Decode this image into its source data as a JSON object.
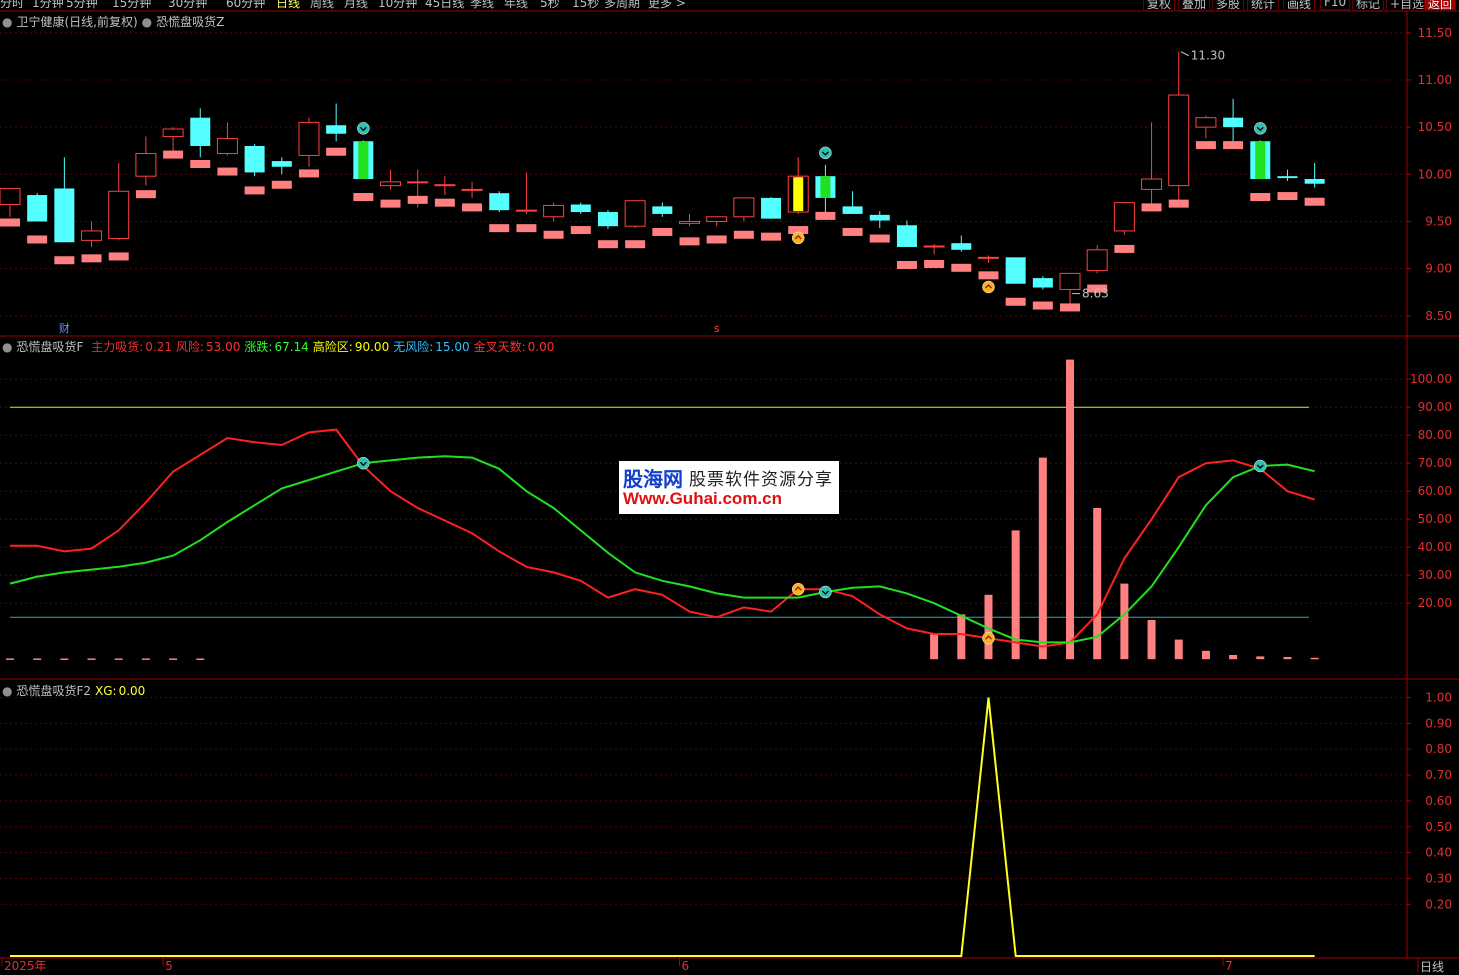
{
  "toolbar": {
    "left_items": [
      "分时",
      "1分钟",
      "5分钟",
      "15分钟",
      "30分钟",
      "60分钟",
      "日线",
      "周线",
      "月线",
      "10分钟",
      "45日线",
      "季线",
      "年线",
      "5秒",
      "15秒",
      "多周期",
      "更多 >"
    ],
    "active_item": "日线",
    "right_items": [
      "复权",
      "叠加",
      "多股",
      "统计",
      "画线",
      "F10",
      "标记",
      "+自选",
      "返回"
    ]
  },
  "panes": {
    "main": {
      "stock": "卫宁健康(日线,前复权)",
      "indicator": "恐慌盘吸货Z",
      "high_label": "11.30",
      "low_label": "8.63",
      "markers": [
        "财",
        "s"
      ]
    },
    "ind1": {
      "name": "恐慌盘吸货F",
      "items": [
        {
          "label": "主力吸货:",
          "value": "0.21",
          "color": "#e03030"
        },
        {
          "label": "风险:",
          "value": "53.00",
          "color": "#ff3030"
        },
        {
          "label": "涨跌:",
          "value": "67.14",
          "color": "#30ff30"
        },
        {
          "label": "高险区:",
          "value": "90.00",
          "color": "#ffff00"
        },
        {
          "label": "无风险:",
          "value": "15.00",
          "color": "#30c0ff"
        },
        {
          "label": "金叉天数:",
          "value": "0.00",
          "color": "#ff3030"
        }
      ]
    },
    "ind2": {
      "name": "恐慌盘吸货F2",
      "label": "XG:",
      "value": "0.00"
    }
  },
  "watermark": {
    "site": "股海网",
    "slogan": "股票软件资源分享",
    "url": "Www.Guhai.com.cn"
  },
  "period_label": "日线",
  "dates": [
    {
      "text": "2025年",
      "i": 0
    },
    {
      "text": "5",
      "i": 6
    },
    {
      "text": "6",
      "i": 25
    },
    {
      "text": "7",
      "i": 45
    }
  ],
  "chart_data": [
    {
      "type": "candlestick",
      "y_ticks": [
        8.5,
        9.0,
        9.5,
        10.0,
        10.5,
        11.0,
        11.5
      ],
      "ylim": [
        8.35,
        11.72
      ],
      "candles": [
        {
          "o": 9.68,
          "h": 9.85,
          "l": 9.55,
          "c": 9.85
        },
        {
          "o": 9.78,
          "h": 9.8,
          "l": 9.55,
          "c": 9.5
        },
        {
          "o": 9.85,
          "h": 10.18,
          "l": 9.28,
          "c": 9.28
        },
        {
          "o": 9.3,
          "h": 9.5,
          "l": 9.23,
          "c": 9.4
        },
        {
          "o": 9.32,
          "h": 10.12,
          "l": 9.3,
          "c": 9.82
        },
        {
          "o": 9.98,
          "h": 10.4,
          "l": 9.88,
          "c": 10.22
        },
        {
          "o": 10.4,
          "h": 10.5,
          "l": 10.25,
          "c": 10.48
        },
        {
          "o": 10.6,
          "h": 10.7,
          "l": 10.18,
          "c": 10.3
        },
        {
          "o": 10.22,
          "h": 10.55,
          "l": 10.2,
          "c": 10.38
        },
        {
          "o": 10.3,
          "h": 10.32,
          "l": 9.98,
          "c": 10.02
        },
        {
          "o": 10.14,
          "h": 10.18,
          "l": 10.0,
          "c": 10.08
        },
        {
          "o": 10.2,
          "h": 10.6,
          "l": 10.08,
          "c": 10.55
        },
        {
          "o": 10.52,
          "h": 10.75,
          "l": 10.35,
          "c": 10.43
        },
        {
          "o": 10.35,
          "h": 10.36,
          "l": 9.95,
          "c": 9.95
        },
        {
          "o": 9.88,
          "h": 10.05,
          "l": 9.84,
          "c": 9.92
        },
        {
          "o": 9.92,
          "h": 10.05,
          "l": 9.65,
          "c": 9.92
        },
        {
          "o": 9.89,
          "h": 9.98,
          "l": 9.78,
          "c": 9.89
        },
        {
          "o": 9.84,
          "h": 9.92,
          "l": 9.75,
          "c": 9.84
        },
        {
          "o": 9.8,
          "h": 9.82,
          "l": 9.6,
          "c": 9.62
        },
        {
          "o": 9.62,
          "h": 10.02,
          "l": 9.58,
          "c": 9.62
        },
        {
          "o": 9.55,
          "h": 9.7,
          "l": 9.5,
          "c": 9.67
        },
        {
          "o": 9.68,
          "h": 9.7,
          "l": 9.58,
          "c": 9.6
        },
        {
          "o": 9.6,
          "h": 9.62,
          "l": 9.42,
          "c": 9.45
        },
        {
          "o": 9.45,
          "h": 9.72,
          "l": 9.43,
          "c": 9.72
        },
        {
          "o": 9.66,
          "h": 9.7,
          "l": 9.55,
          "c": 9.58
        },
        {
          "o": 9.48,
          "h": 9.58,
          "l": 9.45,
          "c": 9.5
        },
        {
          "o": 9.5,
          "h": 9.55,
          "l": 9.45,
          "c": 9.55
        },
        {
          "o": 9.55,
          "h": 9.75,
          "l": 9.5,
          "c": 9.75
        },
        {
          "o": 9.75,
          "h": 9.76,
          "l": 9.53,
          "c": 9.53
        },
        {
          "o": 9.6,
          "h": 10.18,
          "l": 9.58,
          "c": 9.98
        },
        {
          "o": 9.98,
          "h": 10.1,
          "l": 9.55,
          "c": 9.75
        },
        {
          "o": 9.66,
          "h": 9.82,
          "l": 9.58,
          "c": 9.58
        },
        {
          "o": 9.57,
          "h": 9.61,
          "l": 9.43,
          "c": 9.51
        },
        {
          "o": 9.46,
          "h": 9.51,
          "l": 9.23,
          "c": 9.23
        },
        {
          "o": 9.24,
          "h": 9.26,
          "l": 9.15,
          "c": 9.24
        },
        {
          "o": 9.27,
          "h": 9.35,
          "l": 9.18,
          "c": 9.2
        },
        {
          "o": 9.12,
          "h": 9.14,
          "l": 9.06,
          "c": 9.12
        },
        {
          "o": 9.12,
          "h": 9.12,
          "l": 8.84,
          "c": 8.84
        },
        {
          "o": 8.9,
          "h": 8.92,
          "l": 8.78,
          "c": 8.8
        },
        {
          "o": 8.78,
          "h": 8.95,
          "l": 8.63,
          "c": 8.95
        },
        {
          "o": 8.98,
          "h": 9.25,
          "l": 8.95,
          "c": 9.2
        },
        {
          "o": 9.4,
          "h": 9.7,
          "l": 9.36,
          "c": 9.7
        },
        {
          "o": 9.84,
          "h": 10.55,
          "l": 9.64,
          "c": 9.95
        },
        {
          "o": 9.88,
          "h": 11.3,
          "l": 9.73,
          "c": 10.84
        },
        {
          "o": 10.5,
          "h": 10.62,
          "l": 10.38,
          "c": 10.6
        },
        {
          "o": 10.6,
          "h": 10.8,
          "l": 10.32,
          "c": 10.5
        },
        {
          "o": 10.35,
          "h": 10.36,
          "l": 9.95,
          "c": 9.95
        },
        {
          "o": 9.98,
          "h": 10.05,
          "l": 9.93,
          "c": 9.96
        },
        {
          "o": 9.95,
          "h": 10.12,
          "l": 9.86,
          "c": 9.9
        }
      ],
      "yellow_candles": [
        29
      ],
      "green_candles": [
        13,
        30,
        46
      ],
      "icons_down": [
        13,
        30,
        46
      ],
      "icons_up": [
        29,
        36
      ]
    },
    {
      "type": "line",
      "title": "恐慌盘吸货F",
      "y_ticks": [
        20,
        30,
        40,
        50,
        60,
        70,
        80,
        90,
        100
      ],
      "ylim": [
        -6,
        114
      ],
      "series": [
        {
          "name": "风险",
          "color": "#ff2020",
          "values": [
            40.5,
            40.5,
            38.5,
            39.5,
            46,
            56,
            67,
            73,
            79,
            77.5,
            76.5,
            81,
            82,
            69,
            60,
            54,
            49.5,
            45,
            38.5,
            33,
            31,
            28,
            22,
            25,
            23,
            17,
            15,
            18.5,
            17,
            25,
            25,
            22.5,
            16,
            11,
            9,
            9,
            7.5,
            6,
            4.5,
            6,
            16,
            36,
            50,
            65,
            70,
            71,
            68,
            60,
            57
          ]
        },
        {
          "name": "涨跌",
          "color": "#20e020",
          "values": [
            27,
            29.5,
            31,
            32,
            33,
            34.5,
            37,
            42.5,
            49,
            55,
            61,
            64,
            67,
            70,
            71,
            72,
            72.5,
            72,
            68,
            60,
            54,
            46,
            38,
            31,
            28,
            26,
            23.5,
            22,
            22,
            22,
            24,
            25.5,
            26,
            23.5,
            20,
            15.5,
            11,
            7,
            6,
            6,
            8,
            16,
            26,
            40,
            55,
            65,
            69,
            69.5,
            67.14
          ]
        }
      ],
      "bars": {
        "color": "#ff8080",
        "values": [
          0,
          0,
          0,
          0,
          0,
          0,
          0,
          0,
          0,
          0,
          0,
          0,
          0,
          0,
          0,
          0,
          0,
          0,
          0,
          0,
          0,
          0,
          0,
          0,
          0,
          0,
          0,
          0,
          0,
          0,
          0,
          0,
          0,
          0,
          9,
          16,
          23,
          46,
          72,
          107,
          54,
          27,
          14,
          7,
          3,
          1.5,
          1,
          0.8,
          0.5
        ]
      },
      "hlines": [
        {
          "value": 90,
          "color": "#e8e800"
        },
        {
          "value": 15,
          "color": "#20b0b0"
        }
      ],
      "baseline_dashes": [
        0,
        1,
        2,
        3,
        4,
        5,
        6,
        7
      ],
      "icons_up": [
        29,
        36
      ],
      "icons_down": [
        13,
        30,
        46
      ]
    },
    {
      "type": "line",
      "title": "恐慌盘吸货F2",
      "y_ticks": [
        0.2,
        0.3,
        0.4,
        0.5,
        0.6,
        0.7,
        0.8,
        0.9,
        1.0
      ],
      "ylim": [
        0,
        1.06
      ],
      "series": [
        {
          "name": "XG",
          "color": "#ffff20",
          "values": [
            0,
            0,
            0,
            0,
            0,
            0,
            0,
            0,
            0,
            0,
            0,
            0,
            0,
            0,
            0,
            0,
            0,
            0,
            0,
            0,
            0,
            0,
            0,
            0,
            0,
            0,
            0,
            0,
            0,
            0,
            0,
            0,
            0,
            0,
            0,
            0,
            1,
            0,
            0,
            0,
            0,
            0,
            0,
            0,
            0,
            0,
            0,
            0,
            0
          ]
        }
      ]
    }
  ]
}
